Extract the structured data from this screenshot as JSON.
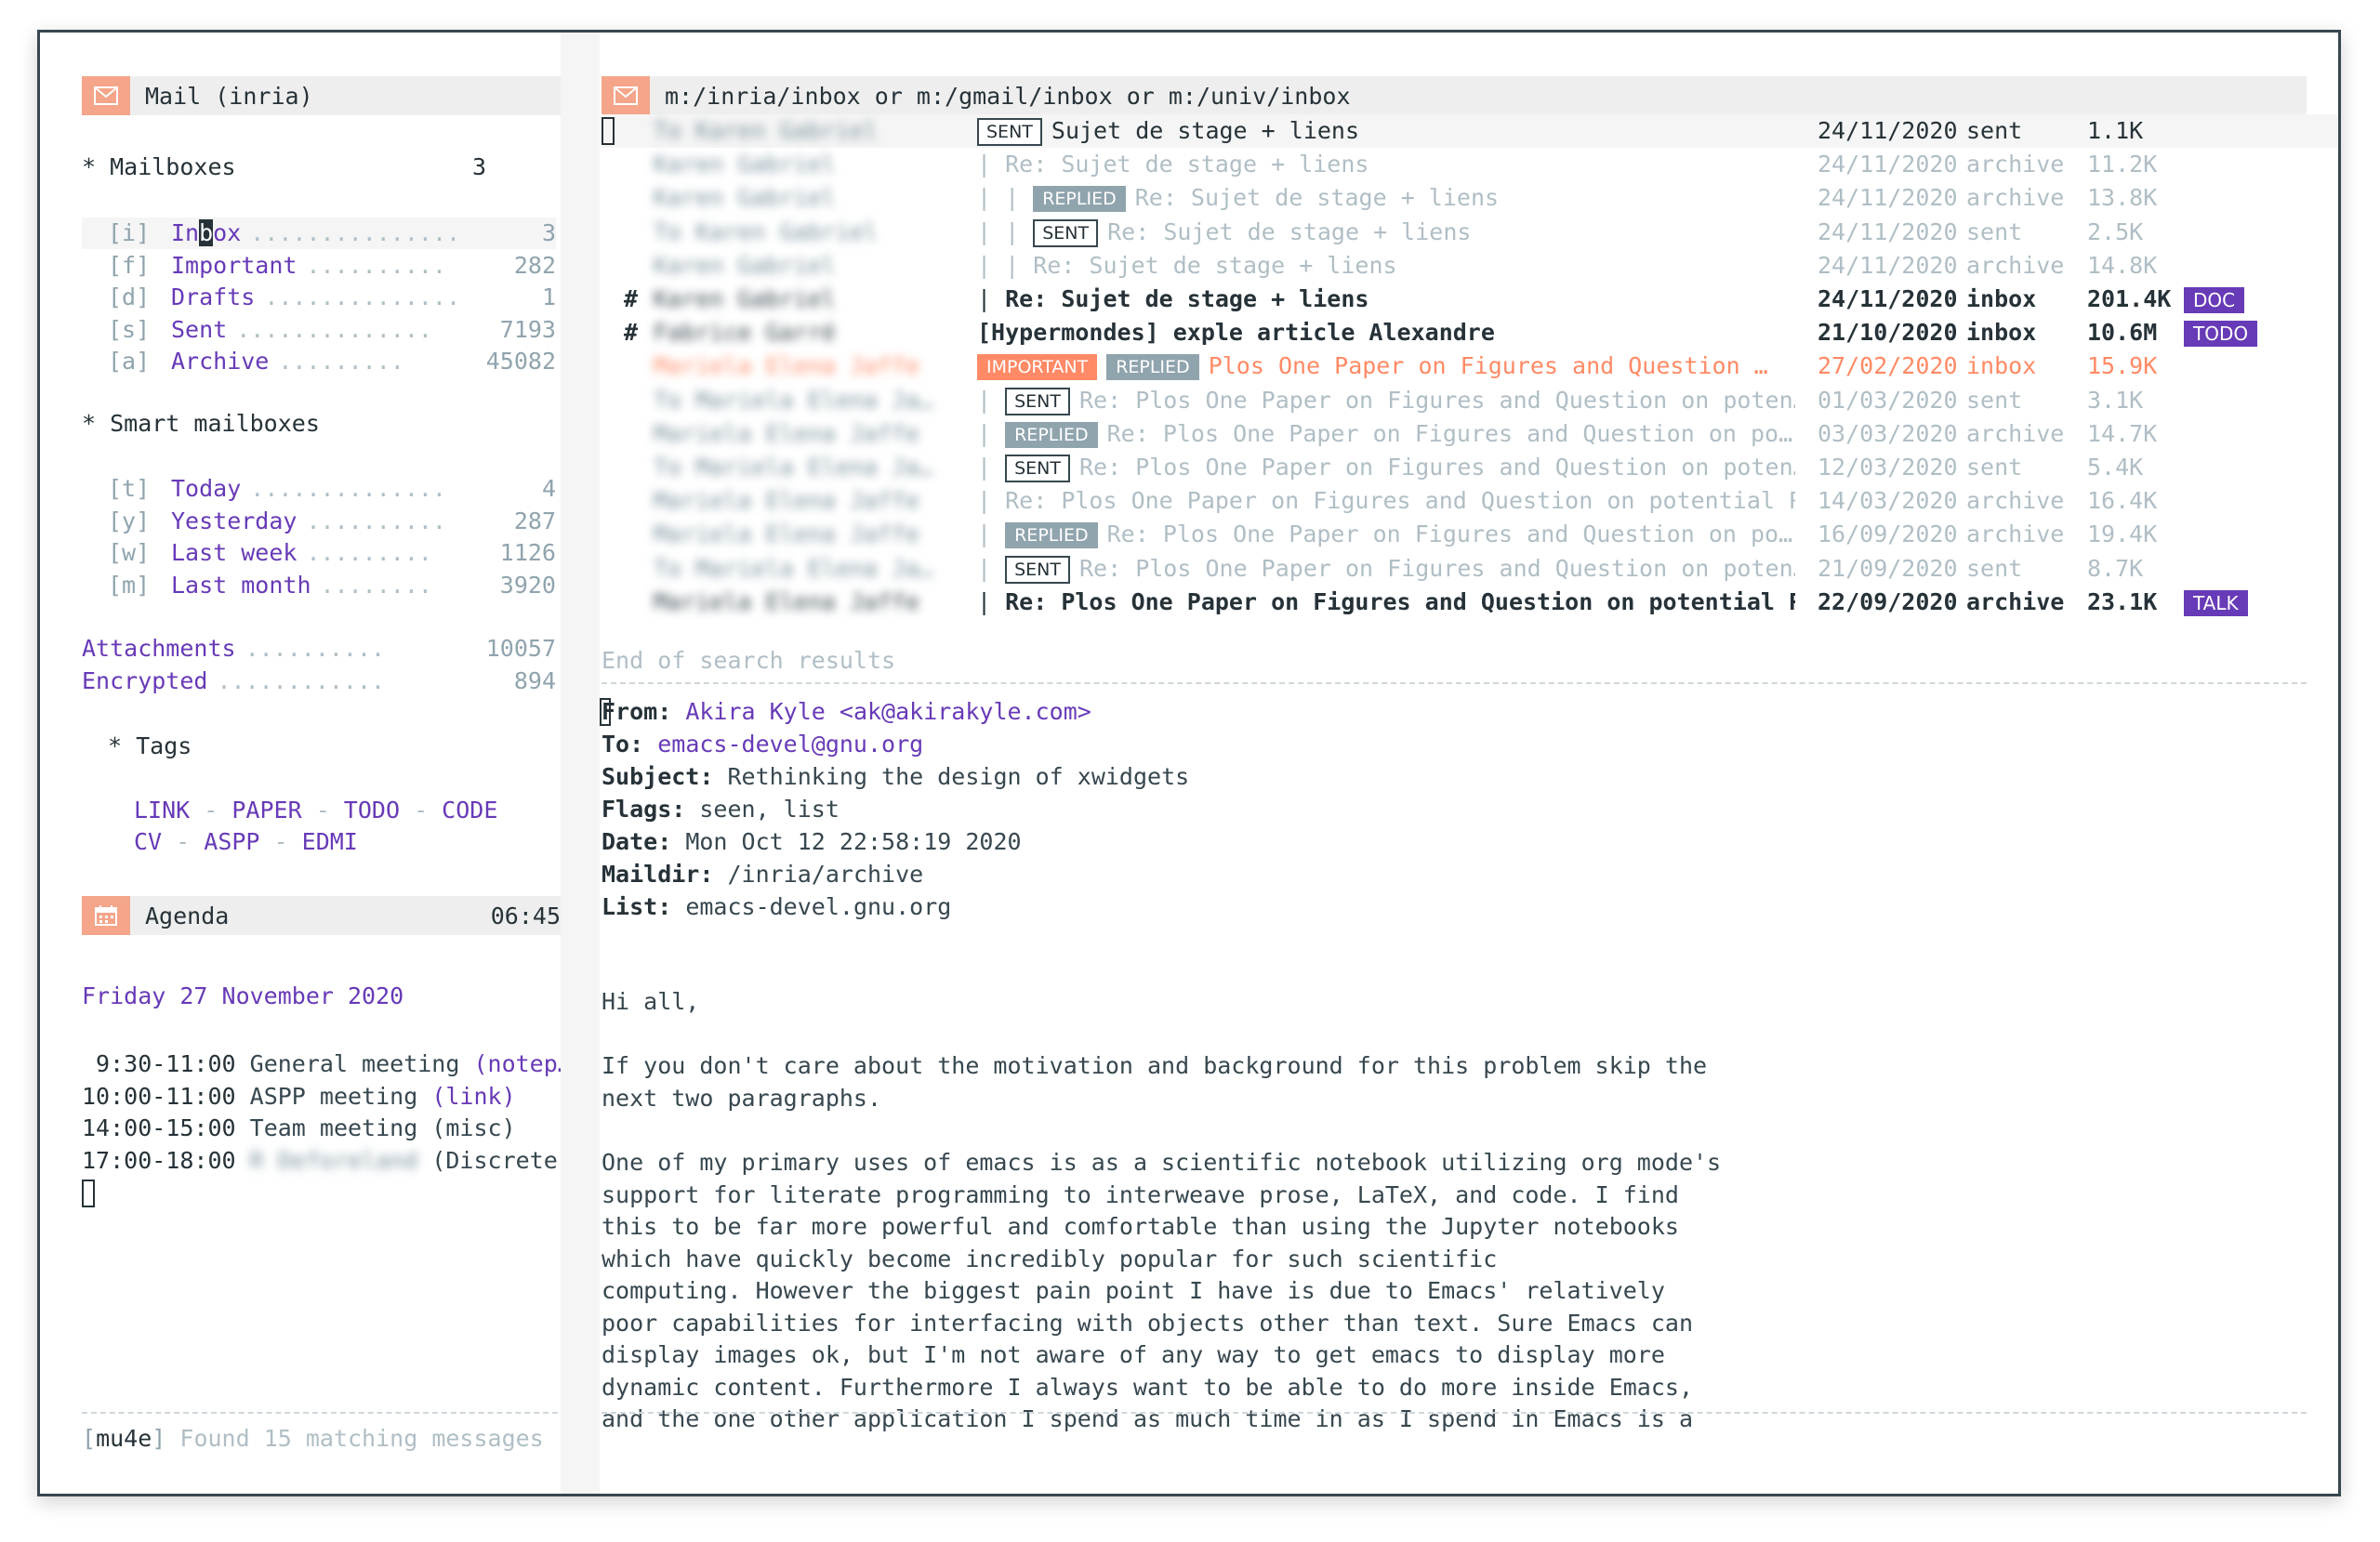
{
  "left": {
    "mail_header": "Mail (inria)",
    "mailboxes_title": "* Mailboxes",
    "mailboxes_count": "3",
    "mailboxes": [
      {
        "key": "[i]",
        "name_pre": "In",
        "name_cursor": "b",
        "name_post": "ox",
        "dots": "...............",
        "count": "3"
      },
      {
        "key": "[f]",
        "name": "Important",
        "dots": "..........",
        "count": "282"
      },
      {
        "key": "[d]",
        "name": "Drafts",
        "dots": "..............",
        "count": "1"
      },
      {
        "key": "[s]",
        "name": "Sent",
        "dots": "..............",
        "count": "7193"
      },
      {
        "key": "[a]",
        "name": "Archive",
        "dots": ".........",
        "count": "45082"
      }
    ],
    "smart_title": "* Smart mailboxes",
    "smart": [
      {
        "key": "[t]",
        "name": "Today",
        "dots": "..............",
        "count": "4"
      },
      {
        "key": "[y]",
        "name": "Yesterday",
        "dots": "..........",
        "count": "287"
      },
      {
        "key": "[w]",
        "name": "Last week",
        "dots": ".........",
        "count": "1126"
      },
      {
        "key": "[m]",
        "name": "Last month",
        "dots": "........",
        "count": "3920"
      }
    ],
    "extra": [
      {
        "name": "Attachments",
        "dots": "..........",
        "count": "10057"
      },
      {
        "name": "Encrypted",
        "dots": "............",
        "count": "894"
      }
    ],
    "tags_title": "* Tags",
    "tags_line1": [
      "LINK",
      "PAPER",
      "TODO",
      "CODE"
    ],
    "tags_line2": [
      "CV",
      "ASPP",
      "EDMI"
    ],
    "tag_sep": " - ",
    "agenda_header": "Agenda",
    "agenda_time": "06:45",
    "agenda_date": "Friday 27 November 2020",
    "agenda": [
      {
        "time": " 9:30-11:00",
        "text": "General meeting ",
        "extra": "(notep…"
      },
      {
        "time": "10:00-11:00",
        "text": "ASPP meeting ",
        "extra": "(link)"
      },
      {
        "time": "14:00-15:00",
        "text": "Team meeting (misc)",
        "extra": ""
      },
      {
        "time": "17:00-18:00",
        "text": "",
        "blurred": "R Deforeland",
        "tail": " (Discrete …"
      }
    ],
    "status_bracket_open": "[",
    "status_mode": "mu4e",
    "status_bracket_close": "]",
    "status_text": " Found 15 matching messages"
  },
  "right": {
    "query": "m:/inria/inbox or m:/gmail/inbox or m:/univ/inbox",
    "messages": [
      {
        "mark": "",
        "from": "To Karen Gabriel",
        "tree": "",
        "flags": [
          "SENT"
        ],
        "subject": "Sujet de stage + liens",
        "date": "24/11/2020",
        "maildir": "sent",
        "size": "1.1K",
        "tag": "",
        "style": "normal"
      },
      {
        "mark": "",
        "from": "Karen Gabriel",
        "tree": "| ",
        "flags": [],
        "subject": "Re: Sujet de stage + liens",
        "date": "24/11/2020",
        "maildir": "archive",
        "size": "11.2K",
        "tag": "",
        "style": "dim"
      },
      {
        "mark": "",
        "from": "Karen Gabriel",
        "tree": "| | ",
        "flags": [
          "REPLIED"
        ],
        "subject": "Re: Sujet de stage + liens",
        "date": "24/11/2020",
        "maildir": "archive",
        "size": "13.8K",
        "tag": "",
        "style": "dim"
      },
      {
        "mark": "",
        "from": "To Karen Gabriel",
        "tree": "| | ",
        "flags": [
          "SENT"
        ],
        "subject": "Re: Sujet de stage + liens",
        "date": "24/11/2020",
        "maildir": "sent",
        "size": "2.5K",
        "tag": "",
        "style": "dim"
      },
      {
        "mark": "",
        "from": "Karen Gabriel",
        "tree": "| | ",
        "flags": [],
        "subject": "Re: Sujet de stage + liens",
        "date": "24/11/2020",
        "maildir": "archive",
        "size": "14.8K",
        "tag": "",
        "style": "dim"
      },
      {
        "mark": "#",
        "from": "Karen Gabriel",
        "tree": "| ",
        "flags": [],
        "subject": "Re: Sujet de stage + liens",
        "date": "24/11/2020",
        "maildir": "inbox",
        "size": "201.4K",
        "tag": "DOC",
        "style": "unread"
      },
      {
        "mark": "#",
        "from": "Fabrice Garré",
        "tree": "",
        "flags": [],
        "subject": "[Hypermondes] exple article Alexandre",
        "date": "21/10/2020",
        "maildir": "inbox",
        "size": "10.6M",
        "tag": "TODO",
        "style": "unread"
      },
      {
        "mark": "",
        "from": "Mariela Elena Jaffe",
        "tree": "",
        "flags": [
          "IMPORTANT",
          "REPLIED"
        ],
        "subject": "Plos One Paper on Figures and Question …",
        "date": "27/02/2020",
        "maildir": "inbox",
        "size": "15.9K",
        "tag": "",
        "style": "important"
      },
      {
        "mark": "",
        "from": "To Mariela Elena Ja…",
        "tree": "| ",
        "flags": [
          "SENT"
        ],
        "subject": "Re: Plos One Paper on Figures and Question on poten…",
        "date": "01/03/2020",
        "maildir": "sent",
        "size": "3.1K",
        "tag": "",
        "style": "dim"
      },
      {
        "mark": "",
        "from": "Mariela Elena Jaffe",
        "tree": "| ",
        "flags": [
          "REPLIED"
        ],
        "subject": "Re: Plos One Paper on Figures and Question on po…",
        "date": "03/03/2020",
        "maildir": "archive",
        "size": "14.7K",
        "tag": "",
        "style": "dim"
      },
      {
        "mark": "",
        "from": "To Mariela Elena Ja…",
        "tree": "| ",
        "flags": [
          "SENT"
        ],
        "subject": "Re: Plos One Paper on Figures and Question on poten…",
        "date": "12/03/2020",
        "maildir": "sent",
        "size": "5.4K",
        "tag": "",
        "style": "dim"
      },
      {
        "mark": "",
        "from": "Mariela Elena Jaffe",
        "tree": "| ",
        "flags": [],
        "subject": "Re: Plos One Paper on Figures and Question on potential P…",
        "date": "14/03/2020",
        "maildir": "archive",
        "size": "16.4K",
        "tag": "",
        "style": "dim"
      },
      {
        "mark": "",
        "from": "Mariela Elena Jaffe",
        "tree": "| ",
        "flags": [
          "REPLIED"
        ],
        "subject": "Re: Plos One Paper on Figures and Question on po…",
        "date": "16/09/2020",
        "maildir": "archive",
        "size": "19.4K",
        "tag": "",
        "style": "dim"
      },
      {
        "mark": "",
        "from": "To Mariela Elena Ja…",
        "tree": "| ",
        "flags": [
          "SENT"
        ],
        "subject": "Re: Plos One Paper on Figures and Question on poten…",
        "date": "21/09/2020",
        "maildir": "sent",
        "size": "8.7K",
        "tag": "",
        "style": "dim"
      },
      {
        "mark": "",
        "from": "Mariela Elena Jaffe",
        "tree": "| ",
        "flags": [],
        "subject": "Re: Plos One Paper on Figures and Question on potential P…",
        "date": "22/09/2020",
        "maildir": "archive",
        "size": "23.1K",
        "tag": "TALK",
        "style": "unread"
      }
    ],
    "end_text": "End of search results",
    "headers": {
      "from_label": "From:",
      "from_value": "Akira Kyle <ak@akirakyle.com>",
      "to_label": "To:",
      "to_value": "emacs-devel@gnu.org",
      "subject_label": "Subject:",
      "subject_value": "Rethinking the design of xwidgets",
      "flags_label": "Flags:",
      "flags_value": "seen, list",
      "date_label": "Date:",
      "date_value": "Mon Oct 12 22:58:19 2020",
      "maildir_label": "Maildir:",
      "maildir_value": "/inria/archive",
      "list_label": "List:",
      "list_value": "emacs-devel.gnu.org"
    },
    "body": {
      "p1": "Hi all,",
      "p2": "If you don't care about the motivation and background for this problem skip the\nnext two paragraphs.",
      "p3": "One of my primary uses of emacs is as a scientific notebook utilizing org mode's\nsupport for literate programming to interweave prose, LaTeX, and code. I find\nthis to be far more powerful and comfortable than using the Jupyter notebooks\nwhich have quickly become incredibly popular for such scientific\ncomputing. However the biggest pain point I have is due to Emacs' relatively\npoor capabilities for interfacing with objects other than text. Sure Emacs can\ndisplay images ok, but I'm not aware of any way to get emacs to display more\ndynamic content. Furthermore I always want to be able to do more inside Emacs,\nand the one other application I spend as much time in as I spend in Emacs is a"
    }
  },
  "colors": {
    "accent": "#673ab7",
    "header_icon": "#f4a58a",
    "important": "#ff8a65",
    "replied": "#90a4ae"
  },
  "icons": {
    "mail": "envelope-icon",
    "agenda": "calendar-icon"
  }
}
